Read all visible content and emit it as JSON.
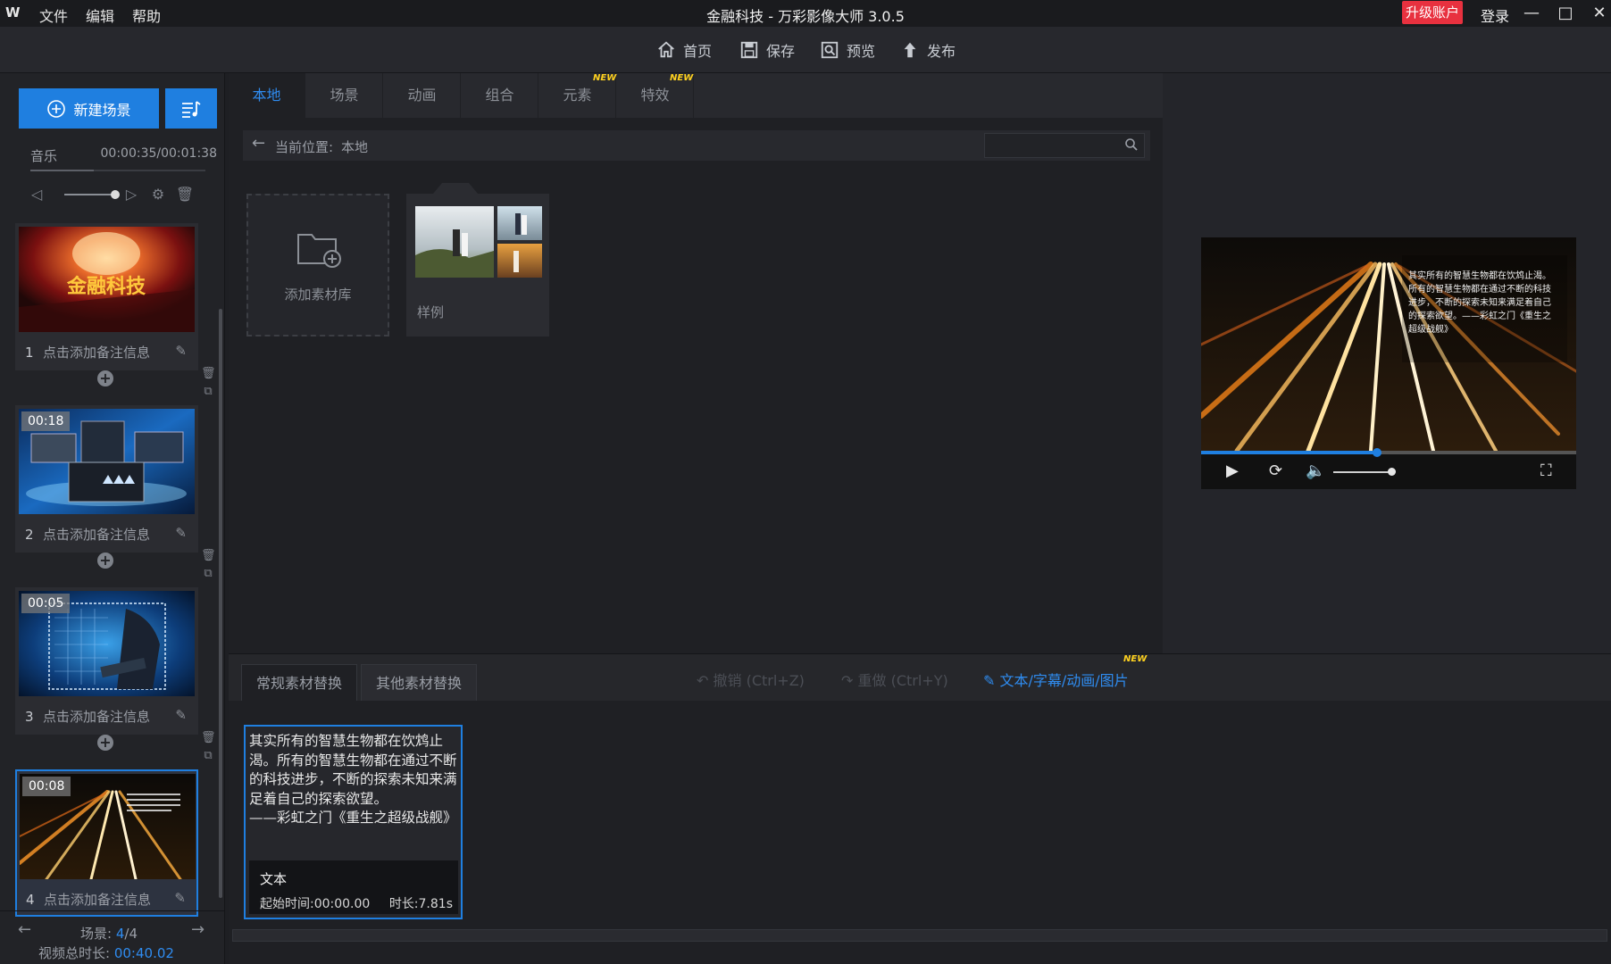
{
  "app": {
    "window_title": "金融科技 - 万彩影像大师 3.0.5",
    "menu": [
      "文件",
      "编辑",
      "帮助"
    ],
    "upgrade_label": "升级账户",
    "login_label": "登录"
  },
  "toolbar": {
    "home": "首页",
    "save": "保存",
    "preview": "预览",
    "publish": "发布"
  },
  "left_panel": {
    "new_scene_label": "新建场景",
    "music": {
      "label": "音乐",
      "time": "00:00:35/00:01:38",
      "progress": 0.36,
      "volume": 1.0
    },
    "scenes": [
      {
        "index": "1",
        "note": "点击添加备注信息",
        "duration": "",
        "active": false
      },
      {
        "index": "2",
        "note": "点击添加备注信息",
        "duration": "00:18",
        "active": false
      },
      {
        "index": "3",
        "note": "点击添加备注信息",
        "duration": "00:05",
        "active": false
      },
      {
        "index": "4",
        "note": "点击添加备注信息",
        "duration": "00:08",
        "active": true
      }
    ],
    "scene1_title_text": "金融科技",
    "scene_nav": {
      "label": "场景:",
      "current": "4",
      "total": "/4",
      "total_duration_label": "视频总时长:",
      "total_duration": "00:40.02"
    }
  },
  "resource_panel": {
    "tabs": [
      "本地",
      "场景",
      "动画",
      "组合",
      "元素",
      "特效"
    ],
    "active_tab": "本地",
    "new_badge": "NEW",
    "location_label": "当前位置:",
    "location_value": "本地",
    "search_placeholder": "",
    "add_library_label": "添加素材库",
    "sample_folder_label": "样例"
  },
  "preview": {
    "quote": "其实所有的智慧生物都在饮鸩止渴。所有的智慧生物都在通过不断的科技进步，不断的探索未知来满足着自己的探索欲望。——彩虹之门《重生之超级战舰》",
    "progress": 0.47,
    "volume": 1.0
  },
  "bottom_panel": {
    "tabs": [
      "常规素材替换",
      "其他素材替换"
    ],
    "undo": "撤销 (Ctrl+Z)",
    "redo": "重做 (Ctrl+Y)",
    "text_edit": "文本/字幕/动画/图片",
    "new_badge": "NEW",
    "text_card": {
      "lines": [
        "其实所有的智慧生物都在饮鸩止",
        "渴。所有的智慧生物都在通过不断",
        "的科技进步，不断的探索未知来满",
        "足着自己的探索欲望。",
        "——彩虹之门《重生之超级战舰》"
      ],
      "type": "文本",
      "start_time": "起始时间:00:00.00",
      "duration": "时长:7.81s"
    }
  },
  "colors": {
    "accent": "#1f7fe0",
    "upgrade": "#e8313f",
    "badge": "#ffd21f"
  }
}
